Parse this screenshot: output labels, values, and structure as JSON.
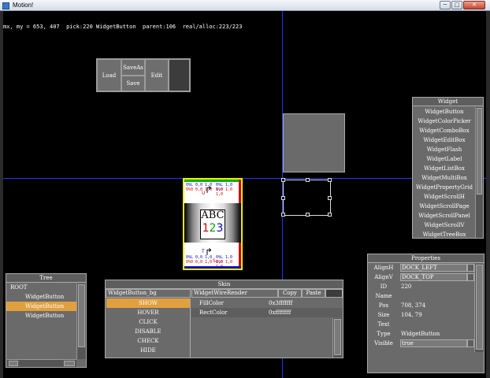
{
  "window": {
    "title": "Motion!",
    "minimize": "─",
    "maximize": "□",
    "close": "✕"
  },
  "status": "mx, my = 653, 407  pick:220 WidgetButton  parent:106  real/alloc:223/223",
  "toolbar": {
    "load": "Load",
    "saveas": "SaveAs",
    "save": "Save",
    "edit": "Edit"
  },
  "preview": {
    "tl_line1": "0%L 0,0 1,0",
    "tl_line2": "0%0 0,0 1,0",
    "tr_line1": "0%L 1,0 1,0",
    "tr_line2": "0%0 1,0 1,0",
    "bl_line1": "0%L 0,0 1,0",
    "bl_line2": "0%0 0,0 1,0",
    "br_line1": "0%L 1,0 1,0",
    "br_line2": "0%0 1,0 1,0",
    "abc": "ABC",
    "d1": "1",
    "d2": "2",
    "d3": "3",
    "letter_u": "U",
    "letter_t": "T",
    "letter_s": "S",
    "arrow": "↱"
  },
  "widget_panel": {
    "title": "Widget",
    "items": [
      "WidgetButton",
      "WidgetColorPicker",
      "WidgetComboBox",
      "WidgetEditBox",
      "WidgetFlash",
      "WidgetLabel",
      "WidgetListBox",
      "WidgetMultiBox",
      "WidgetPropertyGrid",
      "WidgetScrollH",
      "WidgetScrollPage",
      "WidgetScrollPanel",
      "WidgetScrollV",
      "WidgetTreeBox"
    ]
  },
  "tree_panel": {
    "title": "Tree",
    "root": "ROOT",
    "children": [
      "WidgetButton",
      "WidgetButton",
      "WidgetButton"
    ],
    "selected_index": 1
  },
  "skin_panel": {
    "title": "Skin",
    "skin_name": "WidgetButton_bg",
    "renderer": "WidgetWireRender",
    "copy": "Copy",
    "paste": "Paste",
    "states": [
      "SHOW",
      "HOVER",
      "CLICK",
      "DISABLE",
      "CHECK",
      "HIDE"
    ],
    "selected_state": 0,
    "rows": [
      {
        "key": "FillColor",
        "value": "0x3fffffff"
      },
      {
        "key": "RectColor",
        "value": "0xffffffff"
      }
    ]
  },
  "props_panel": {
    "title": "Properties",
    "rows": [
      {
        "key": "AlignH",
        "value": "DOCK_LEFT",
        "type": "dropdown"
      },
      {
        "key": "AlignV",
        "value": "DOCK_TOP",
        "type": "dropdown"
      },
      {
        "key": "ID",
        "value": "220",
        "type": "text"
      },
      {
        "key": "Name",
        "value": "",
        "type": "text"
      },
      {
        "key": "Pos",
        "value": "708, 374",
        "type": "text"
      },
      {
        "key": "Size",
        "value": "104, 79",
        "type": "text"
      },
      {
        "key": "Text",
        "value": "",
        "type": "text"
      },
      {
        "key": "Type",
        "value": "WidgetButton",
        "type": "text"
      },
      {
        "key": "Visible",
        "value": "true",
        "type": "dropdown"
      }
    ]
  },
  "colors": {
    "accent_selected": "#e0a040",
    "crosshair": "#2233ff",
    "panel_bg": "#6a6a6a"
  }
}
